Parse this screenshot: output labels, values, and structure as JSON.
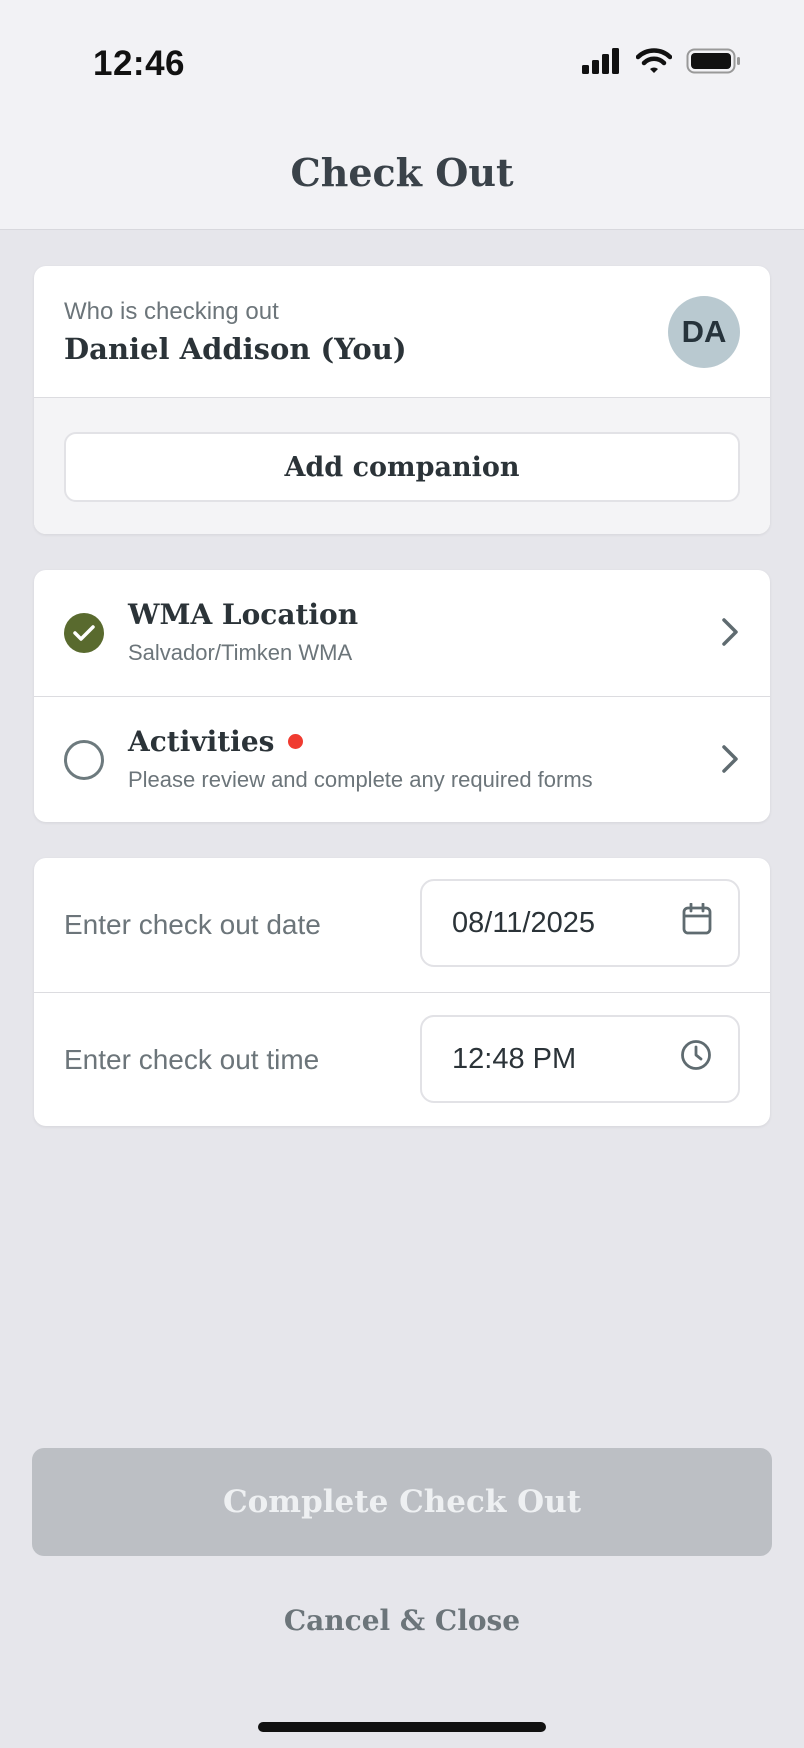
{
  "status_bar": {
    "time": "12:46"
  },
  "header": {
    "title": "Check Out"
  },
  "checker": {
    "label": "Who is checking out",
    "name": "Daniel Addison (You)",
    "initials": "DA",
    "add_companion_label": "Add companion"
  },
  "items": [
    {
      "title": "WMA Location",
      "subtitle": "Salvador/Timken WMA",
      "complete": true
    },
    {
      "title": "Activities",
      "subtitle": "Please review and complete any required forms",
      "complete": false,
      "required_indicator": true
    }
  ],
  "checkout": {
    "date_label": "Enter check out date",
    "date_value": "08/11/2025",
    "time_label": "Enter check out time",
    "time_value": "12:48 PM"
  },
  "actions": {
    "complete_label": "Complete Check Out",
    "cancel_label": "Cancel & Close"
  },
  "colors": {
    "accent_green": "#596a2e",
    "required_red": "#f03b30",
    "disabled_button": "#bcbfc4"
  },
  "icons": [
    "cellular-signal-icon",
    "wifi-icon",
    "battery-icon",
    "checkmark-icon",
    "chevron-right-icon",
    "calendar-icon",
    "clock-icon"
  ]
}
